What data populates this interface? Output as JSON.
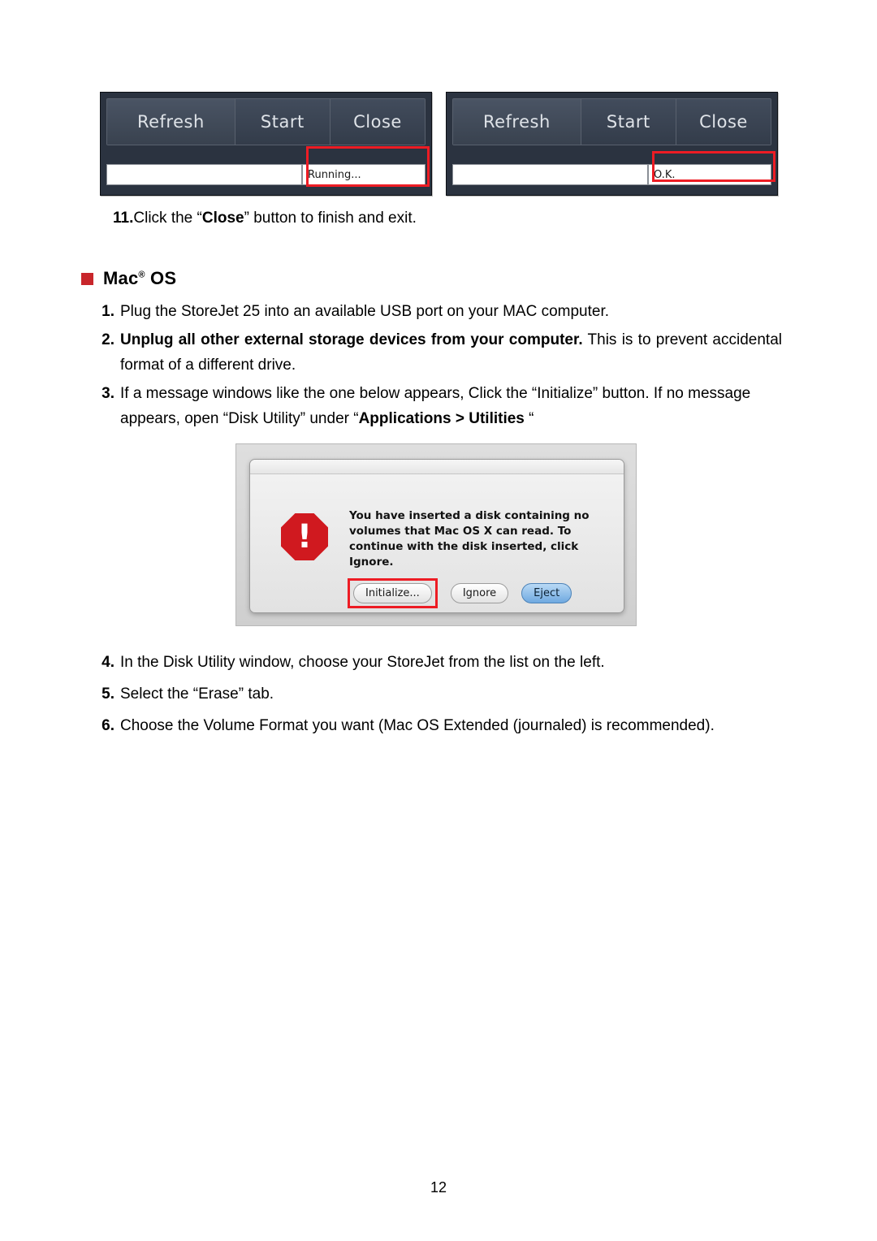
{
  "screenshots": [
    {
      "name": "running-screenshot",
      "buttons": [
        "Refresh",
        "Start",
        "Close"
      ],
      "status_value": "Running...",
      "highlight_color": "#ed1c24"
    },
    {
      "name": "ok-screenshot",
      "buttons": [
        "Refresh",
        "Start",
        "Close"
      ],
      "status_value": "O.K.",
      "highlight_color": "#ed1c24"
    }
  ],
  "step11": {
    "number": "11.",
    "pre": "Click the “",
    "bold": "Close",
    "post": "” button to finish and exit."
  },
  "mac_section": {
    "bullet_color": "#c8262b",
    "title": "Mac",
    "title_sup": "®",
    "title_rest": "OS"
  },
  "steps": [
    {
      "num": "1.",
      "text": "Plug the StoreJet 25 into an available USB port on your MAC computer."
    },
    {
      "num": "2.",
      "bold_lead": "Unplug all other external storage devices from your computer.",
      "text": " This is to prevent accidental format of a different drive."
    },
    {
      "num": "3.",
      "text_a": "If a message windows like the one below appears, Click the “Initialize” button. If no message appears, open “Disk Utility” under “",
      "bold_b": "Applications > Utilities",
      "text_c": " “"
    }
  ],
  "mac_dialog": {
    "alert_symbol": "!",
    "message": "You have inserted a disk containing no volumes that Mac OS X can read.  To continue with the disk inserted, click Ignore.",
    "buttons": [
      {
        "label": "Initialize...",
        "style": "default",
        "highlighted": true
      },
      {
        "label": "Ignore",
        "style": "default",
        "highlighted": false
      },
      {
        "label": "Eject",
        "style": "blue",
        "highlighted": false
      }
    ]
  },
  "steps2": [
    {
      "num": "4.",
      "text": "In the Disk Utility window, choose your StoreJet from the list on the left."
    },
    {
      "num": "5.",
      "text": "Select the “Erase” tab."
    },
    {
      "num": "6.",
      "text": "Choose the Volume Format you want (Mac OS Extended (journaled) is recommended)."
    }
  ],
  "page_number": "12"
}
